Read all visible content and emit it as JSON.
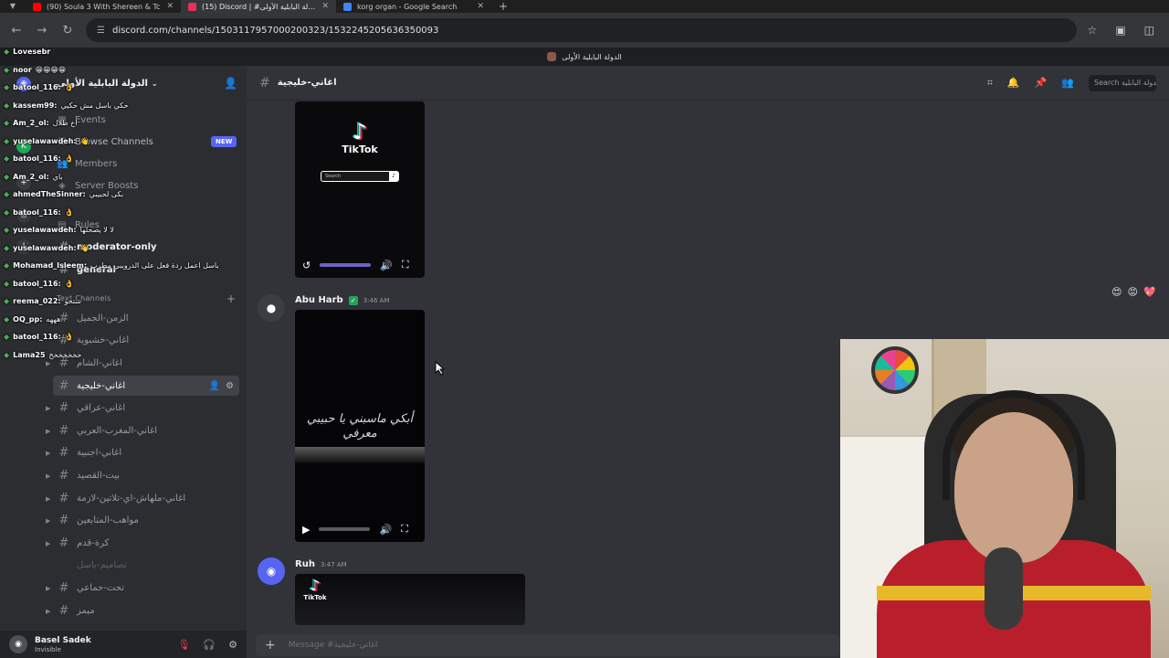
{
  "browser": {
    "tabs": [
      {
        "title": "(90) Soula 3 With Shereen & Tc",
        "color": "#ff0000",
        "active": false
      },
      {
        "title": "(15) Discord | #اغاني-خليجية | الدولة البابلية الأولى",
        "color": "#e8305a",
        "active": true
      },
      {
        "title": "korg organ - Google Search",
        "color": "#4285f4",
        "active": false
      }
    ],
    "url": "discord.com/channels/1503117957000200323/1532245205636350093"
  },
  "discord": {
    "title_bar": "الدولة البابلية الأولى",
    "server_name": "الدولة البابلية الأولى",
    "nav": {
      "events": "Events",
      "browse": "Browse Channels",
      "browse_badge": "NEW",
      "members": "Members",
      "boosts": "Server Boosts",
      "rules": "Rules"
    },
    "category": "Text Channels",
    "channels": [
      {
        "name": "moderator-only",
        "style": "bold"
      },
      {
        "name": "general",
        "style": "bold"
      },
      {
        "name": "الزمن-الجميل",
        "style": "normal"
      },
      {
        "name": "اغاني-خشبوية",
        "style": "normal"
      },
      {
        "name": "اغاني-الشام",
        "style": "normal"
      },
      {
        "name": "اغاني-خليجية",
        "style": "selected"
      },
      {
        "name": "اغاني-عراقي",
        "style": "normal"
      },
      {
        "name": "اغاني-المغرب-العربي",
        "style": "normal"
      },
      {
        "name": "اغاني-اجنبية",
        "style": "normal"
      },
      {
        "name": "بيت-القصيد",
        "style": "normal"
      },
      {
        "name": "اغاني-ملهاش-اي-تلاتين-لازمة",
        "style": "normal"
      },
      {
        "name": "مواهب-المتابعين",
        "style": "normal"
      },
      {
        "name": "كرة-قدم",
        "style": "normal"
      },
      {
        "name": "تصاميم-باسل",
        "style": "muted"
      },
      {
        "name": "تحت-حماعي",
        "style": "normal"
      },
      {
        "name": "ميمز",
        "style": "normal"
      }
    ],
    "user": {
      "name": "Basel Sadek",
      "status": "Invisible"
    },
    "channel_header": {
      "name": "اغاني-خليجية",
      "search_placeholder": "Search الدولة البابلية"
    },
    "messages": [
      {
        "author": "Abu Harb",
        "time": "3:46 AM",
        "caption": "أبكي ماسبني يا حبيبي معرفي"
      },
      {
        "author": "Ruh",
        "time": "3:47 AM"
      }
    ],
    "tiktok_label": "TikTok",
    "tiktok_search": "Search",
    "composer_placeholder": "Message #اغاني-خليجية"
  },
  "stream_chat": [
    {
      "user": "Lovesebr",
      "msg": ""
    },
    {
      "user": "noor",
      "msg": "😁😁😁😁"
    },
    {
      "user": "batool_116:",
      "msg": "👌"
    },
    {
      "user": "kassem99:",
      "msg": "حكي باسل مش حكيي"
    },
    {
      "user": "Am_2_ol:",
      "msg": "اخ طلال"
    },
    {
      "user": "yuselawawdeh:",
      "msg": "👋"
    },
    {
      "user": "batool_116:",
      "msg": "👌"
    },
    {
      "user": "Am_2_ol:",
      "msg": "باي"
    },
    {
      "user": "ahmedTheSinner:",
      "msg": "بكى لحبيبي"
    },
    {
      "user": "batool_116:",
      "msg": "👌"
    },
    {
      "user": "yuselawawdeh:",
      "msg": "لا لا يصحلها"
    },
    {
      "user": "yuselawawdeh:",
      "msg": "👋"
    },
    {
      "user": "Mohamad_Isleem:",
      "msg": "باسل اعمل ردة فعل على الدرويبي مطرب"
    },
    {
      "user": "batool_116:",
      "msg": "👌"
    },
    {
      "user": "reema_022:",
      "msg": "ستحو"
    },
    {
      "user": "OQ_pp:",
      "msg": "هههه"
    },
    {
      "user": "batool_116:",
      "msg": "👌"
    },
    {
      "user": "Lama25",
      "msg": "خخخخخخخ"
    }
  ],
  "reactions": [
    "😍",
    "😡",
    "💖"
  ]
}
